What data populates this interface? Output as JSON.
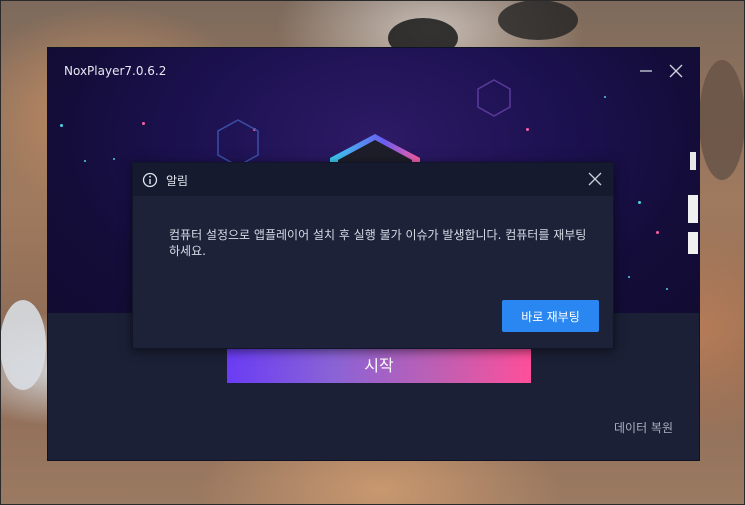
{
  "window": {
    "title": "NoxPlayer7.0.6.2",
    "minimize_icon": "minimize-icon",
    "close_icon": "close-icon"
  },
  "main": {
    "start_label": "시작",
    "restore_label": "데이터 복원"
  },
  "alert": {
    "title": "알림",
    "info_icon": "info-icon",
    "close_icon": "close-icon",
    "message": "컴퓨터 설정으로 앱플레이어 설치 후 실행 불가 이슈가 발생합니다. 컴퓨터를 재부팅하세요.",
    "button_label": "바로 재부팅"
  },
  "colors": {
    "start_gradient_start": "#6a3cf5",
    "start_gradient_end": "#ff4f9a",
    "reboot_button": "#2a86f0",
    "dialog_bg": "#1d2239",
    "hero_bg": "#1c1150"
  }
}
